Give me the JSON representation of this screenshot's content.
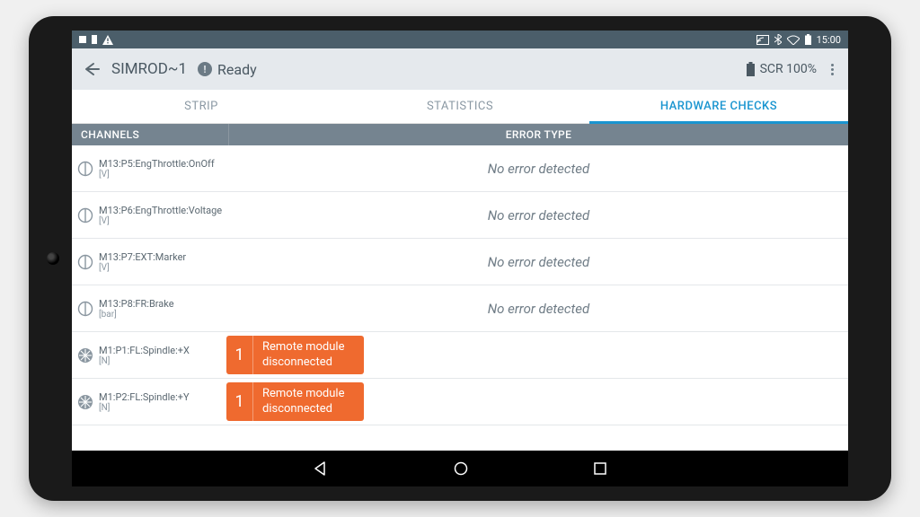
{
  "statusbar": {
    "time": "15:00"
  },
  "appbar": {
    "title": "SIMROD~1",
    "status_label": "Ready",
    "status_glyph": "!",
    "scr_label": "SCR 100%"
  },
  "tabs": [
    {
      "label": "STRIP",
      "active": false
    },
    {
      "label": "STATISTICS",
      "active": false
    },
    {
      "label": "HARDWARE CHECKS",
      "active": true
    }
  ],
  "columns": {
    "c1": "CHANNELS",
    "c2": "ERROR TYPE"
  },
  "rows": [
    {
      "icon": "rotary",
      "name": "M13:P5:EngThrottle:OnOff",
      "unit": "[V]",
      "error": null
    },
    {
      "icon": "rotary",
      "name": "M13:P6:EngThrottle:Voltage",
      "unit": "[V]",
      "error": null
    },
    {
      "icon": "rotary",
      "name": "M13:P7:EXT:Marker",
      "unit": "[V]",
      "error": null
    },
    {
      "icon": "rotary",
      "name": "M13:P8:FR:Brake",
      "unit": "[bar]",
      "error": null
    },
    {
      "icon": "snow",
      "name": "M1:P1:FL:Spindle:+X",
      "unit": "[N]",
      "error": {
        "count": "1",
        "line1": "Remote module",
        "line2": "disconnected"
      }
    },
    {
      "icon": "snow",
      "name": "M1:P2:FL:Spindle:+Y",
      "unit": "[N]",
      "error": {
        "count": "1",
        "line1": "Remote module",
        "line2": "disconnected"
      }
    }
  ],
  "no_error_text": "No error detected"
}
